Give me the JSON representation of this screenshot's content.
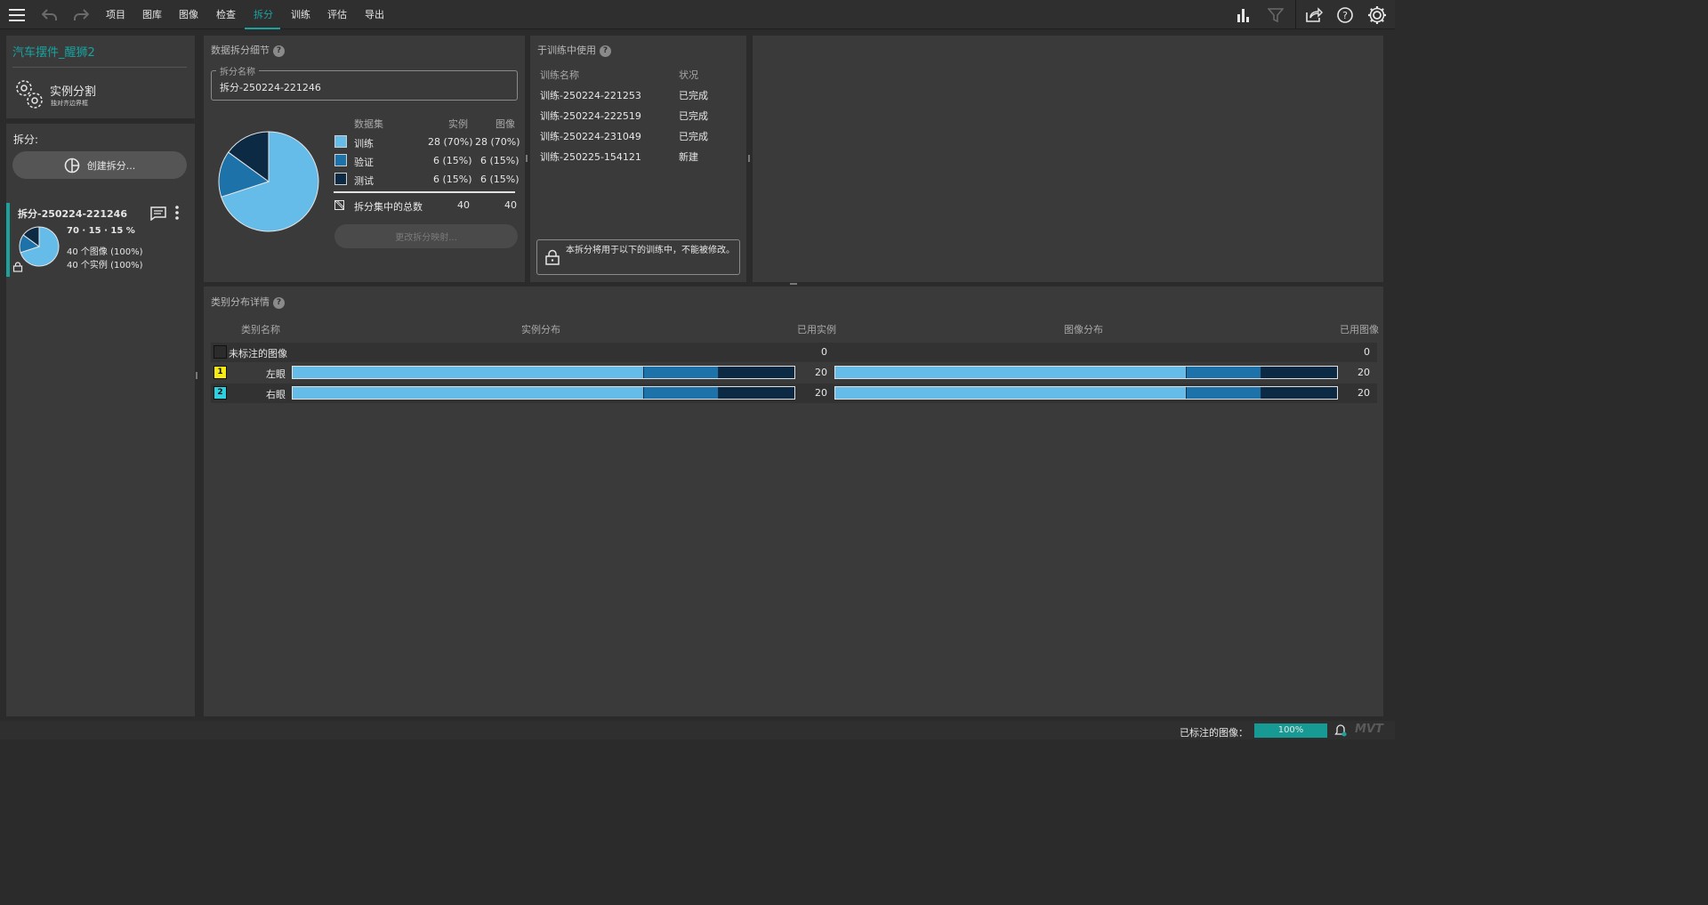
{
  "menu": {
    "items": [
      "项目",
      "图库",
      "图像",
      "检查",
      "拆分",
      "训练",
      "评估",
      "导出"
    ],
    "active_index": 4
  },
  "sidebar": {
    "project_title": "汽车摆件_醒狮2",
    "project_type": "实例分割",
    "project_subtype": "独对齐边界框",
    "splits_label": "拆分:",
    "create_split_label": "创建拆分...",
    "split_item": {
      "name": "拆分-250224-221246",
      "ratio": "70 · 15 · 15 %",
      "images": "40 个图像 (100%)",
      "instances": "40 个实例 (100%)"
    }
  },
  "split_details": {
    "title": "数据拆分细节",
    "name_label": "拆分名称",
    "name_value": "拆分-250224-221246",
    "headers": {
      "dataset": "数据集",
      "instances": "实例",
      "images": "图像"
    },
    "rows": [
      {
        "name": "训练",
        "instances": "28 (70%)",
        "images": "28 (70%)",
        "color": "#66bce8"
      },
      {
        "name": "验证",
        "instances": "6 (15%)",
        "images": "6 (15%)",
        "color": "#1d72a9"
      },
      {
        "name": "测试",
        "instances": "6 (15%)",
        "images": "6 (15%)",
        "color": "#0c2a44"
      }
    ],
    "total": {
      "name": "拆分集中的总数",
      "instances": "40",
      "images": "40"
    },
    "change_mapping_label": "更改拆分映射..."
  },
  "used_in_training": {
    "title": "于训练中使用",
    "col_name": "训练名称",
    "col_status": "状况",
    "rows": [
      {
        "name": "训练-250224-221253",
        "status": "已完成"
      },
      {
        "name": "训练-250224-222519",
        "status": "已完成"
      },
      {
        "name": "训练-250224-231049",
        "status": "已完成"
      },
      {
        "name": "训练-250225-154121",
        "status": "新建"
      }
    ],
    "lock_note": "本拆分将用于以下的训练中，不能被修改。"
  },
  "class_distribution": {
    "title": "类别分布详情",
    "headers": {
      "class_name": "类别名称",
      "instance_dist": "实例分布",
      "used_instances": "已用实例",
      "image_dist": "图像分布",
      "used_images": "已用图像"
    },
    "rows": [
      {
        "index": "",
        "name": "未标注的图像",
        "color": "#2b2b2b",
        "used_instances": "0",
        "used_images": "0",
        "train": 0,
        "val": 0,
        "test": 0
      },
      {
        "index": "1",
        "name": "左眼",
        "color": "#f5ea14",
        "used_instances": "20",
        "used_images": "20",
        "train": 0.7,
        "val": 0.15,
        "test": 0.15
      },
      {
        "index": "2",
        "name": "右眼",
        "color": "#2ed0e0",
        "used_instances": "20",
        "used_images": "20",
        "train": 0.7,
        "val": 0.15,
        "test": 0.15
      }
    ]
  },
  "status_bar": {
    "labeled_images_label": "已标注的图像：",
    "labeled_progress": "100%",
    "brand": "MVT"
  }
}
